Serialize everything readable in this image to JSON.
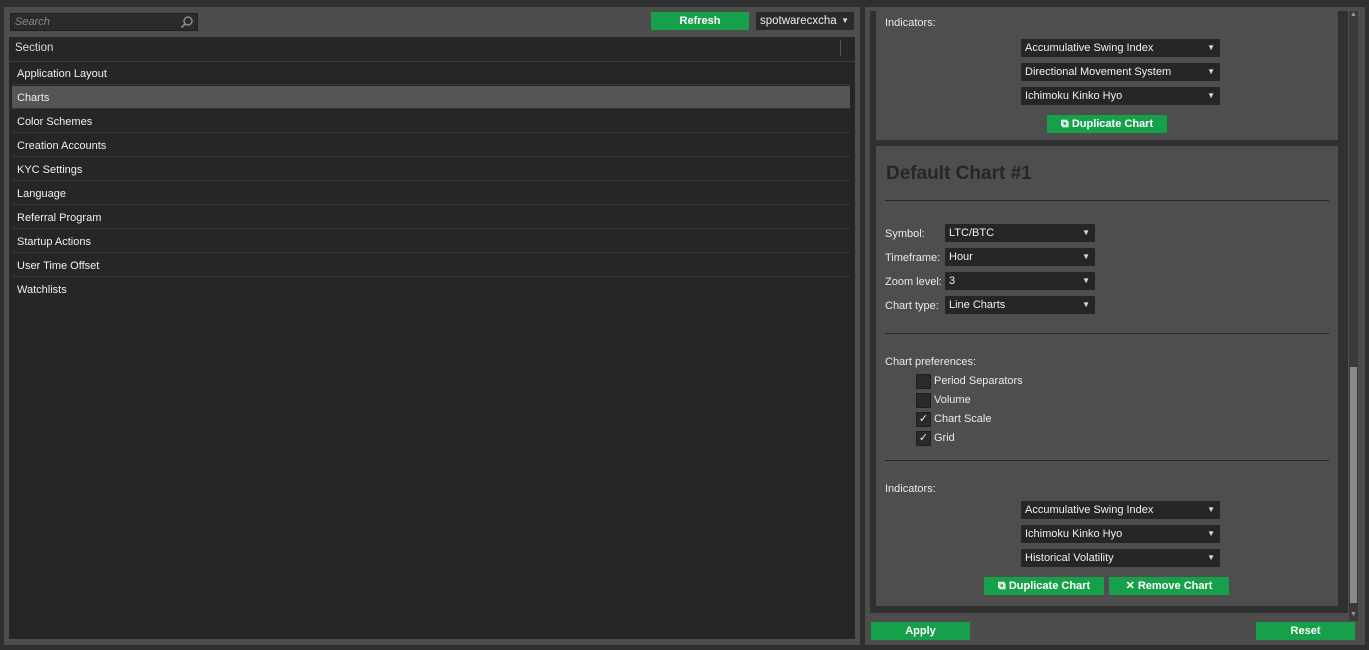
{
  "toolbar": {
    "search_placeholder": "Search",
    "refresh_label": "Refresh",
    "environment": "spotwarecxcha"
  },
  "sections": {
    "header": "Section",
    "items": [
      "Application Layout",
      "Charts",
      "Color Schemes",
      "Creation Accounts",
      "KYC Settings",
      "Language",
      "Referral Program",
      "Startup Actions",
      "User Time Offset",
      "Watchlists"
    ],
    "selected": "Charts"
  },
  "chart_prev": {
    "indicators_label": "Indicators:",
    "indicators": [
      "Accumulative Swing Index",
      "Directional Movement System",
      "Ichimoku Kinko Hyo"
    ],
    "duplicate_label": "Duplicate Chart"
  },
  "chart1": {
    "title": "Default Chart #1",
    "symbol_label": "Symbol:",
    "symbol_value": "LTC/BTC",
    "timeframe_label": "Timeframe:",
    "timeframe_value": "Hour",
    "zoom_label": "Zoom level:",
    "zoom_value": "3",
    "charttype_label": "Chart type:",
    "charttype_value": "Line Charts",
    "prefs_label": "Chart preferences:",
    "prefs": [
      {
        "label": "Period Separators",
        "checked": false
      },
      {
        "label": "Volume",
        "checked": false
      },
      {
        "label": "Chart Scale",
        "checked": true
      },
      {
        "label": "Grid",
        "checked": true
      }
    ],
    "indicators_label": "Indicators:",
    "indicators": [
      "Accumulative Swing Index",
      "Ichimoku Kinko Hyo",
      "Historical Volatility"
    ],
    "duplicate_label": "Duplicate Chart",
    "remove_label": "Remove Chart"
  },
  "footer": {
    "apply_label": "Apply",
    "reset_label": "Reset"
  },
  "colors": {
    "accent_green": "#17a04a",
    "panel_bg": "#4d4d4d",
    "dark_bg": "#262626"
  }
}
